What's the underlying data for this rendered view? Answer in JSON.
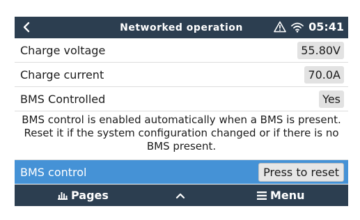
{
  "header": {
    "title": "Networked operation",
    "clock": "05:41",
    "icons": [
      "back-chevron-icon",
      "warning-icon",
      "wifi-icon"
    ]
  },
  "rows": [
    {
      "label": "Charge voltage",
      "value": "55.80V"
    },
    {
      "label": "Charge current",
      "value": "70.0A"
    },
    {
      "label": "BMS Controlled",
      "value": "Yes"
    }
  ],
  "info_text": "BMS control is enabled automatically when a BMS is present. Reset it if the system configuration changed or if there is no BMS present.",
  "bms_control": {
    "label": "BMS control",
    "button_label": "Press to reset"
  },
  "footer": {
    "pages_label": "Pages",
    "menu_label": "Menu",
    "icons": [
      "pages-icon",
      "chevron-up-icon",
      "menu-icon"
    ]
  },
  "colors": {
    "header_bg": "#2c3e50",
    "selected_bg": "#4592d6",
    "value_bg": "#e2e2e2"
  }
}
